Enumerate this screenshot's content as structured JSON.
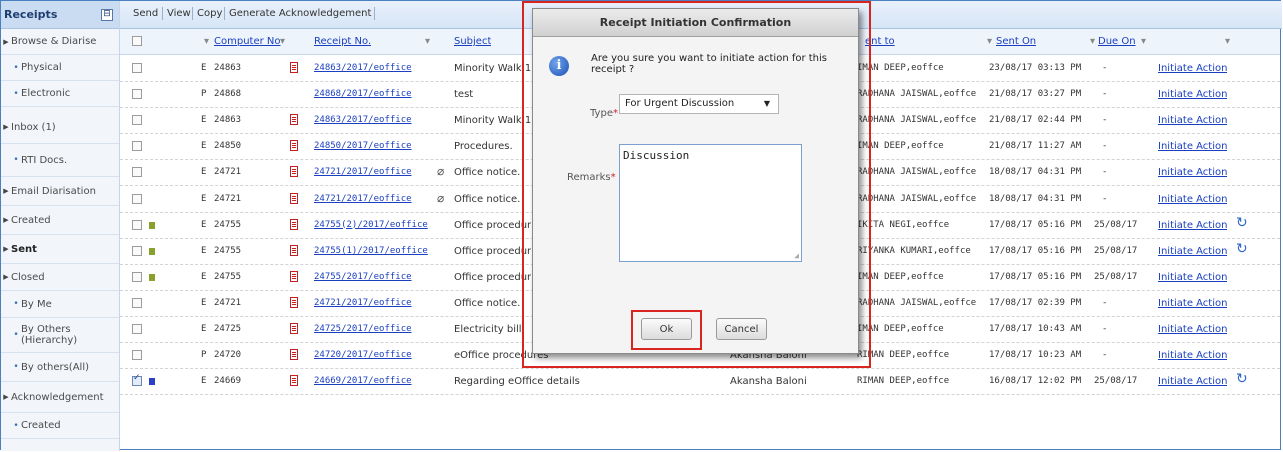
{
  "sidebar": {
    "title": "Receipts",
    "collapse_icon": "⊟",
    "items": [
      {
        "label": "Browse & Diarise",
        "indent": false,
        "bold": false
      },
      {
        "label": "Physical",
        "indent": true,
        "bold": false
      },
      {
        "label": "Electronic",
        "indent": true,
        "bold": false
      },
      {
        "label": "Inbox (1)",
        "indent": false,
        "bold": false
      },
      {
        "label": "RTI Docs.",
        "indent": true,
        "bold": false
      },
      {
        "label": "Email Diarisation",
        "indent": false,
        "bold": false
      },
      {
        "label": "Created",
        "indent": false,
        "bold": false
      },
      {
        "label": "Sent",
        "indent": false,
        "bold": true
      },
      {
        "label": "Closed",
        "indent": false,
        "bold": false
      },
      {
        "label": "By Me",
        "indent": true,
        "bold": false
      },
      {
        "label": "By Others (Hierarchy)",
        "indent": true,
        "bold": false
      },
      {
        "label": "By others(All)",
        "indent": true,
        "bold": false
      },
      {
        "label": "Acknowledgement",
        "indent": false,
        "bold": false
      },
      {
        "label": "Created",
        "indent": true,
        "bold": false
      }
    ]
  },
  "toolbar": {
    "send": "Send",
    "view": "View",
    "copy": "Copy",
    "generate_ack": "Generate Acknowledgement"
  },
  "table": {
    "headers": {
      "computer_no": "Computer No",
      "receipt_no": "Receipt No.",
      "subject": "Subject",
      "sent_to": "ent to",
      "sent_on": "Sent On",
      "due_on": "Due On"
    },
    "rows": [
      {
        "checked": false,
        "flag": "",
        "type": "E",
        "num": "24863",
        "pdf": true,
        "receipt": "24863/2017/eoffice",
        "clip": false,
        "subject": "Minority Walk 1",
        "sent_by": "",
        "sent_to": "IMAN DEEP,eoffce",
        "sent_on": "23/08/17 03:13 PM",
        "due_on": "-",
        "action": "Initiate Action",
        "refresh": false
      },
      {
        "checked": false,
        "flag": "",
        "type": "P",
        "num": "24868",
        "pdf": false,
        "receipt": "24868/2017/eoffice",
        "clip": false,
        "subject": "test",
        "sent_by": "",
        "sent_to": "RADHANA JAISWAL,eoffce",
        "sent_on": "21/08/17 03:27 PM",
        "due_on": "-",
        "action": "Initiate Action",
        "refresh": false
      },
      {
        "checked": false,
        "flag": "",
        "type": "E",
        "num": "24863",
        "pdf": true,
        "receipt": "24863/2017/eoffice",
        "clip": false,
        "subject": "Minority Walk 1",
        "sent_by": "",
        "sent_to": "RADHANA JAISWAL,eoffce",
        "sent_on": "21/08/17 02:44 PM",
        "due_on": "-",
        "action": "Initiate Action",
        "refresh": false
      },
      {
        "checked": false,
        "flag": "",
        "type": "E",
        "num": "24850",
        "pdf": true,
        "receipt": "24850/2017/eoffice",
        "clip": false,
        "subject": "Procedures.",
        "sent_by": "",
        "sent_to": "IMAN DEEP,eoffce",
        "sent_on": "21/08/17 11:27 AM",
        "due_on": "-",
        "action": "Initiate Action",
        "refresh": false
      },
      {
        "checked": false,
        "flag": "",
        "type": "E",
        "num": "24721",
        "pdf": true,
        "receipt": "24721/2017/eoffice",
        "clip": true,
        "subject": "Office notice.",
        "sent_by": "",
        "sent_to": "RADHANA JAISWAL,eoffce",
        "sent_on": "18/08/17 04:31 PM",
        "due_on": "-",
        "action": "Initiate Action",
        "refresh": false
      },
      {
        "checked": false,
        "flag": "",
        "type": "E",
        "num": "24721",
        "pdf": true,
        "receipt": "24721/2017/eoffice",
        "clip": true,
        "subject": "Office notice.",
        "sent_by": "",
        "sent_to": "RADHANA JAISWAL,eoffce",
        "sent_on": "18/08/17 04:31 PM",
        "due_on": "-",
        "action": "Initiate Action",
        "refresh": false
      },
      {
        "checked": false,
        "flag": "#8aa02c",
        "type": "E",
        "num": "24755",
        "pdf": true,
        "receipt": "24755(2)/2017/eoffice",
        "clip": false,
        "subject": "Office procedur",
        "sent_by": "",
        "sent_to": "IKITA NEGI,eoffce",
        "sent_on": "17/08/17 05:16 PM",
        "due_on": "25/08/17",
        "action": "Initiate Action",
        "refresh": true
      },
      {
        "checked": false,
        "flag": "#8aa02c",
        "type": "E",
        "num": "24755",
        "pdf": true,
        "receipt": "24755(1)/2017/eoffice",
        "clip": false,
        "subject": "Office procedur",
        "sent_by": "",
        "sent_to": "RIYANKA KUMARI,eoffce",
        "sent_on": "17/08/17 05:16 PM",
        "due_on": "25/08/17",
        "action": "Initiate Action",
        "refresh": true
      },
      {
        "checked": false,
        "flag": "#8aa02c",
        "type": "E",
        "num": "24755",
        "pdf": true,
        "receipt": "24755/2017/eoffice",
        "clip": false,
        "subject": "Office procedur",
        "sent_by": "",
        "sent_to": "IMAN DEEP,eoffce",
        "sent_on": "17/08/17 05:16 PM",
        "due_on": "25/08/17",
        "action": "Initiate Action",
        "refresh": false
      },
      {
        "checked": false,
        "flag": "",
        "type": "E",
        "num": "24721",
        "pdf": true,
        "receipt": "24721/2017/eoffice",
        "clip": false,
        "subject": "Office notice.",
        "sent_by": "",
        "sent_to": "RADHANA JAISWAL,eoffce",
        "sent_on": "17/08/17 02:39 PM",
        "due_on": "-",
        "action": "Initiate Action",
        "refresh": false
      },
      {
        "checked": false,
        "flag": "",
        "type": "E",
        "num": "24725",
        "pdf": true,
        "receipt": "24725/2017/eoffice",
        "clip": false,
        "subject": "Electricity bill",
        "sent_by": "",
        "sent_to": "IMAN DEEP,eoffce",
        "sent_on": "17/08/17 10:43 AM",
        "due_on": "-",
        "action": "Initiate Action",
        "refresh": false
      },
      {
        "checked": false,
        "flag": "",
        "type": "P",
        "num": "24720",
        "pdf": true,
        "receipt": "24720/2017/eoffice",
        "clip": false,
        "subject": "eOffice procedures",
        "sent_by": "Akansha Baloni",
        "sent_to": "RIMAN DEEP,eoffce",
        "sent_on": "17/08/17 10:23 AM",
        "due_on": "-",
        "action": "Initiate Action",
        "refresh": false
      },
      {
        "checked": true,
        "flag": "#2b3fc8",
        "type": "E",
        "num": "24669",
        "pdf": true,
        "receipt": "24669/2017/eoffice",
        "clip": false,
        "subject": "Regarding eOffice details",
        "sent_by": "Akansha Baloni",
        "sent_to": "RIMAN DEEP,eoffce",
        "sent_on": "16/08/17 12:02 PM",
        "due_on": "25/08/17",
        "action": "Initiate Action",
        "refresh": true
      }
    ]
  },
  "dialog": {
    "title": "Receipt Initiation Confirmation",
    "icon": "i",
    "message": "Are you sure you want to initiate action for this receipt ?",
    "type_label": "Type",
    "type_value": "For Urgent Discussion",
    "remarks_label": "Remarks",
    "remarks_value": "Discussion",
    "required_mark": "*",
    "ok": "Ok",
    "cancel": "Cancel"
  },
  "colors": {
    "accent": "#1a3fc0",
    "highlight": "#d9241f",
    "flag_green": "#8aa02c",
    "flag_blue": "#2b3fc8"
  }
}
